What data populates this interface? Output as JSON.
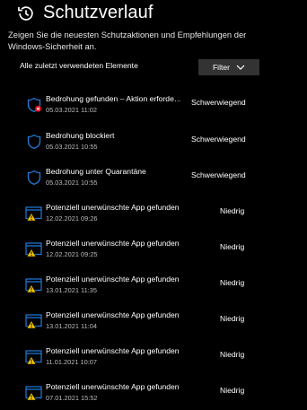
{
  "header": {
    "title": "Schutzverlauf",
    "description": "Zeigen Sie die neuesten Schutzaktionen und Empfehlungen der Windows-Sicherheit an."
  },
  "section": {
    "label": "Alle zuletzt verwendeten Elemente",
    "filter_label": "Filter"
  },
  "colors": {
    "accent": "#1e7bd8",
    "warning": "#f5c800",
    "error": "#e81123"
  },
  "items": [
    {
      "icon": "shield-error-icon",
      "title": "Bedrohung gefunden – Aktion erforde…",
      "date": "05.03.2021 11:02",
      "severity": "Schwerwiegend"
    },
    {
      "icon": "shield-icon",
      "title": "Bedrohung blockiert",
      "date": "05.03.2021 10:55",
      "severity": "Schwerwiegend"
    },
    {
      "icon": "shield-icon",
      "title": "Bedrohung unter Quarantäne",
      "date": "05.03.2021 10:55",
      "severity": "Schwerwiegend"
    },
    {
      "icon": "app-warning-icon",
      "title": "Potenziell unerwünschte App gefunden",
      "date": "12.02.2021 09:26",
      "severity": "Niedrig"
    },
    {
      "icon": "app-warning-icon",
      "title": "Potenziell unerwünschte App gefunden",
      "date": "12.02.2021 09:25",
      "severity": "Niedrig"
    },
    {
      "icon": "app-warning-icon",
      "title": "Potenziell unerwünschte App gefunden",
      "date": "13.01.2021 11:35",
      "severity": "Niedrig"
    },
    {
      "icon": "app-warning-icon",
      "title": "Potenziell unerwünschte App gefunden",
      "date": "13.01.2021 11:04",
      "severity": "Niedrig"
    },
    {
      "icon": "app-warning-icon",
      "title": "Potenziell unerwünschte App gefunden",
      "date": "11.01.2021 10:07",
      "severity": "Niedrig"
    },
    {
      "icon": "app-warning-icon",
      "title": "Potenziell unerwünschte App gefunden",
      "date": "07.01.2021 15:52",
      "severity": "Niedrig"
    }
  ]
}
